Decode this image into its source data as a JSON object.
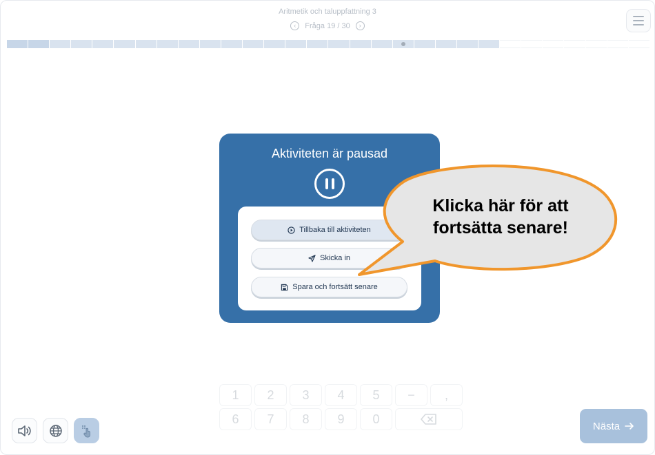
{
  "header": {
    "activity_title": "Aritmetik och taluppfattning 3",
    "question_label": "Fråga 19 / 30"
  },
  "progress": {
    "current": 19,
    "total": 30,
    "answered_segments": 23
  },
  "keypad": {
    "row1": [
      "1",
      "2",
      "3",
      "4",
      "5",
      "−",
      ","
    ],
    "row2": [
      "6",
      "7",
      "8",
      "9",
      "0"
    ]
  },
  "next_button": {
    "label": "Nästa"
  },
  "pause_dialog": {
    "title": "Aktiviteten är pausad",
    "buttons": {
      "resume": "Tillbaka till aktiviteten",
      "submit": "Skicka in",
      "save": "Spara och fortsätt senare"
    }
  },
  "callout": {
    "line1": "Klicka här för att",
    "line2": "fortsätta senare!"
  },
  "colors": {
    "dialog_bg": "#3670a8",
    "callout_fill": "#e6e6e6",
    "callout_border": "#f0962c",
    "next_button": "#a8c1dc"
  },
  "icons": {
    "prev": "chevron-left-circle-icon",
    "next": "chevron-right-circle-icon",
    "menu": "hamburger-menu-icon",
    "pause": "pause-circle-icon",
    "play": "play-circle-icon",
    "send": "paper-plane-icon",
    "save": "floppy-disk-icon",
    "speaker": "speaker-icon",
    "globe": "globe-icon",
    "pointer": "hand-pointer-icon",
    "backspace": "backspace-icon",
    "arrow": "arrow-right-icon"
  }
}
